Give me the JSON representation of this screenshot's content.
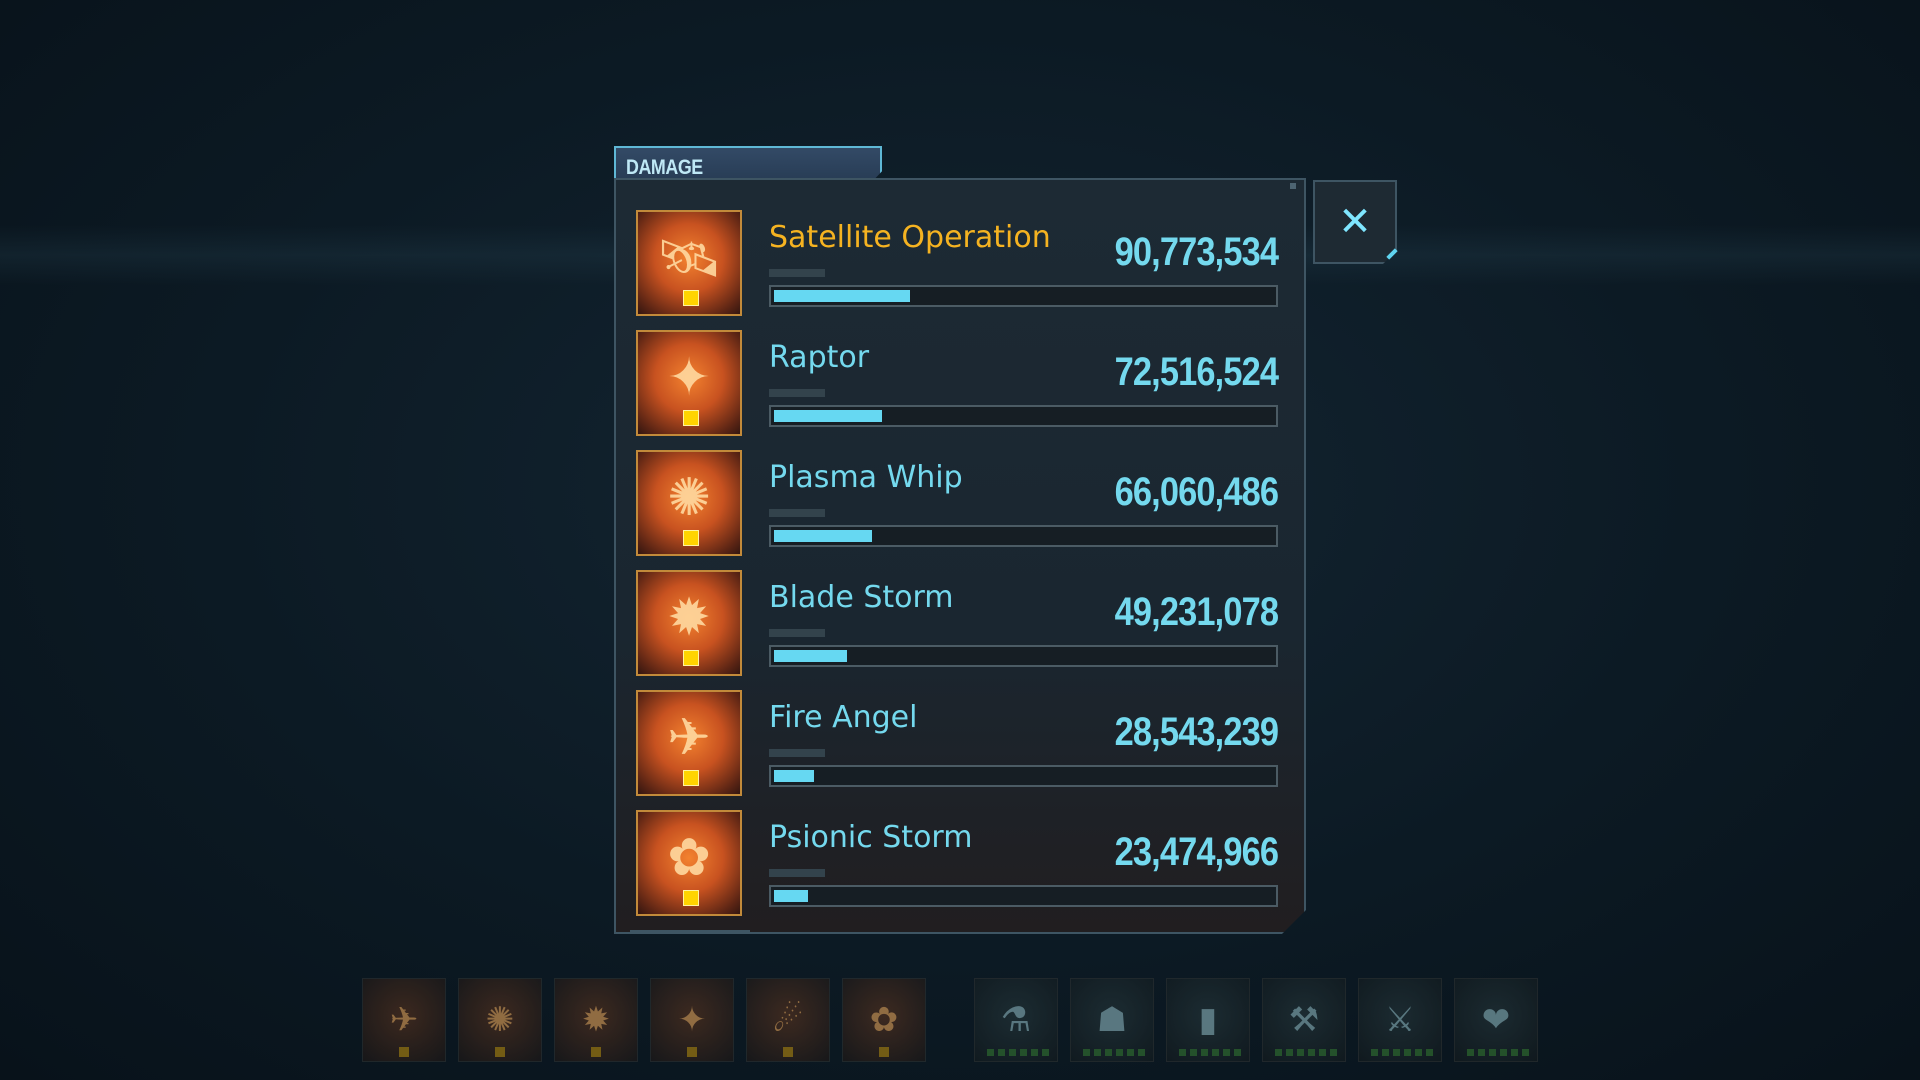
{
  "panel": {
    "tab_label": "DAMAGE",
    "close_symbol": "✕",
    "rows": [
      {
        "name": "Satellite Operation",
        "value": "90,773,534",
        "fraction": 0.27,
        "highlight": true,
        "icon": "satellite-icon",
        "glyph": "🛰"
      },
      {
        "name": "Raptor",
        "value": "72,516,524",
        "fraction": 0.215,
        "highlight": false,
        "icon": "raptor-icon",
        "glyph": "✦"
      },
      {
        "name": "Plasma Whip",
        "value": "66,060,486",
        "fraction": 0.195,
        "highlight": false,
        "icon": "plasma-whip-icon",
        "glyph": "✺"
      },
      {
        "name": "Blade Storm",
        "value": "49,231,078",
        "fraction": 0.145,
        "highlight": false,
        "icon": "blade-storm-icon",
        "glyph": "✹"
      },
      {
        "name": "Fire Angel",
        "value": "28,543,239",
        "fraction": 0.08,
        "highlight": false,
        "icon": "fire-angel-icon",
        "glyph": "✈"
      },
      {
        "name": "Psionic Storm",
        "value": "23,474,966",
        "fraction": 0.068,
        "highlight": false,
        "icon": "psionic-storm-icon",
        "glyph": "✿"
      }
    ]
  },
  "hotbar": {
    "weapons": [
      {
        "icon": "fire-angel-icon",
        "glyph": "✈"
      },
      {
        "icon": "plasma-whip-icon",
        "glyph": "✺"
      },
      {
        "icon": "blade-storm-icon",
        "glyph": "✹"
      },
      {
        "icon": "raptor-icon",
        "glyph": "✦"
      },
      {
        "icon": "satellite-icon",
        "glyph": "☄"
      },
      {
        "icon": "psionic-storm-icon",
        "glyph": "✿"
      }
    ],
    "passives": [
      {
        "icon": "syringe-icon",
        "glyph": "⚗"
      },
      {
        "icon": "boots-icon",
        "glyph": "☗"
      },
      {
        "icon": "battery-icon",
        "glyph": "▮"
      },
      {
        "icon": "arm-icon",
        "glyph": "⚒"
      },
      {
        "icon": "claw-icon",
        "glyph": "⚔"
      },
      {
        "icon": "heart-icon",
        "glyph": "❤"
      }
    ]
  },
  "colors": {
    "accent": "#74d9ee",
    "highlight": "#f5b321",
    "bar": "#66d8f2"
  }
}
